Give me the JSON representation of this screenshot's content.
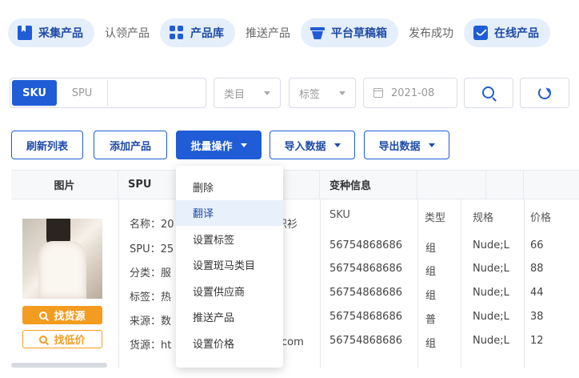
{
  "workflow": {
    "step1": "采集产品",
    "link1": "认领产品",
    "step2": "产品库",
    "link2": "推送产品",
    "step3": "平台草稿箱",
    "link3": "发布成功",
    "step4": "在线产品"
  },
  "filters": {
    "sku": "SKU",
    "spu": "SPU",
    "category": "类目",
    "tag": "标签",
    "date": "2021-08"
  },
  "actions": {
    "refresh": "刷新列表",
    "add": "添加产品",
    "batch": "批量操作",
    "import": "导入数据",
    "export": "导出数据"
  },
  "table": {
    "headers": {
      "image": "图片",
      "spu": "SPU",
      "variant": "变种信息"
    },
    "sub_headers": {
      "sku": "SKU",
      "type": "类型",
      "spec": "规格",
      "price": "价格"
    },
    "product": {
      "name_prefix": "名称：20",
      "name_suffix": "织衫",
      "spu_prefix": "SPU：25",
      "category_prefix": "分类：服",
      "tag_prefix": "标签：热",
      "source_prefix": "来源：数",
      "supply_prefix": "货源：ht",
      "supply_suffix": "com",
      "find_source": "找货源",
      "find_low_price": "找低价"
    },
    "rows": [
      {
        "sku": "56754868686",
        "type": "组",
        "spec": "Nude;L",
        "price": "66"
      },
      {
        "sku": "56754868686",
        "type": "组",
        "spec": "Nude;L",
        "price": "88"
      },
      {
        "sku": "56754868686",
        "type": "组",
        "spec": "Nude;L",
        "price": "44"
      },
      {
        "sku": "56754868686",
        "type": "普",
        "spec": "Nude;L",
        "price": "38"
      },
      {
        "sku": "56754868686",
        "type": "组",
        "spec": "Nude;L",
        "price": "12"
      }
    ]
  },
  "batch_menu": {
    "items": [
      "删除",
      "翻译",
      "设置标签",
      "设置斑马类目",
      "设置供应商",
      "推送产品",
      "设置价格"
    ],
    "active_index": 1
  },
  "colors": {
    "accent": "#1f5cd6",
    "pill_bg": "#e5effb",
    "orange": "#f39c1f"
  }
}
